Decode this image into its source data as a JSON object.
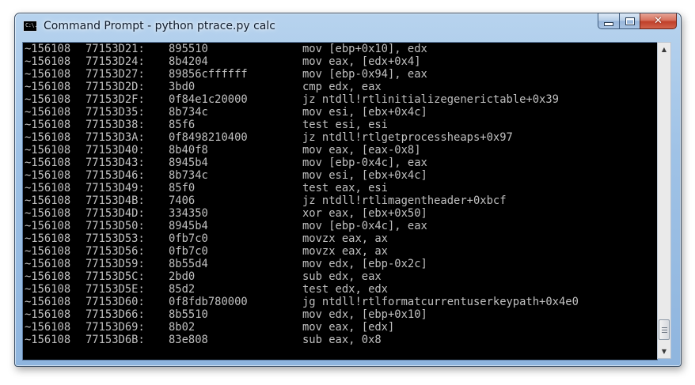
{
  "window": {
    "title": "Command Prompt - python  ptrace.py calc",
    "icon": "cmd-icon",
    "icon_text": "C:\\."
  },
  "caption_buttons": {
    "minimize_icon": "minimize-icon",
    "maximize_icon": "maximize-icon",
    "close_icon": "close-icon",
    "close_glyph": "✕"
  },
  "colors": {
    "console_background": "#000000",
    "console_text": "#c0c0c0"
  },
  "scrollbar": {
    "up_glyph": "▲",
    "down_glyph": "▼"
  },
  "console": {
    "lines": [
      {
        "pid": "~156108",
        "addr": "77153D21:",
        "bytes": "895510",
        "instr": "mov [ebp+0x10], edx"
      },
      {
        "pid": "~156108",
        "addr": "77153D24:",
        "bytes": "8b4204",
        "instr": "mov eax, [edx+0x4]"
      },
      {
        "pid": "~156108",
        "addr": "77153D27:",
        "bytes": "89856cffffff",
        "instr": "mov [ebp-0x94], eax"
      },
      {
        "pid": "~156108",
        "addr": "77153D2D:",
        "bytes": "3bd0",
        "instr": "cmp edx, eax"
      },
      {
        "pid": "~156108",
        "addr": "77153D2F:",
        "bytes": "0f84e1c20000",
        "instr": "jz ntdll!rtlinitializegenerictable+0x39"
      },
      {
        "pid": "~156108",
        "addr": "77153D35:",
        "bytes": "8b734c",
        "instr": "mov esi, [ebx+0x4c]"
      },
      {
        "pid": "~156108",
        "addr": "77153D38:",
        "bytes": "85f6",
        "instr": "test esi, esi"
      },
      {
        "pid": "~156108",
        "addr": "77153D3A:",
        "bytes": "0f8498210400",
        "instr": "jz ntdll!rtlgetprocessheaps+0x97"
      },
      {
        "pid": "~156108",
        "addr": "77153D40:",
        "bytes": "8b40f8",
        "instr": "mov eax, [eax-0x8]"
      },
      {
        "pid": "~156108",
        "addr": "77153D43:",
        "bytes": "8945b4",
        "instr": "mov [ebp-0x4c], eax"
      },
      {
        "pid": "~156108",
        "addr": "77153D46:",
        "bytes": "8b734c",
        "instr": "mov esi, [ebx+0x4c]"
      },
      {
        "pid": "~156108",
        "addr": "77153D49:",
        "bytes": "85f0",
        "instr": "test eax, esi"
      },
      {
        "pid": "~156108",
        "addr": "77153D4B:",
        "bytes": "7406",
        "instr": "jz ntdll!rtlimagentheader+0xbcf"
      },
      {
        "pid": "~156108",
        "addr": "77153D4D:",
        "bytes": "334350",
        "instr": "xor eax, [ebx+0x50]"
      },
      {
        "pid": "~156108",
        "addr": "77153D50:",
        "bytes": "8945b4",
        "instr": "mov [ebp-0x4c], eax"
      },
      {
        "pid": "~156108",
        "addr": "77153D53:",
        "bytes": "0fb7c0",
        "instr": "movzx eax, ax"
      },
      {
        "pid": "~156108",
        "addr": "77153D56:",
        "bytes": "0fb7c0",
        "instr": "movzx eax, ax"
      },
      {
        "pid": "~156108",
        "addr": "77153D59:",
        "bytes": "8b55d4",
        "instr": "mov edx, [ebp-0x2c]"
      },
      {
        "pid": "~156108",
        "addr": "77153D5C:",
        "bytes": "2bd0",
        "instr": "sub edx, eax"
      },
      {
        "pid": "~156108",
        "addr": "77153D5E:",
        "bytes": "85d2",
        "instr": "test edx, edx"
      },
      {
        "pid": "~156108",
        "addr": "77153D60:",
        "bytes": "0f8fdb780000",
        "instr": "jg ntdll!rtlformatcurrentuserkeypath+0x4e0"
      },
      {
        "pid": "~156108",
        "addr": "77153D66:",
        "bytes": "8b5510",
        "instr": "mov edx, [ebp+0x10]"
      },
      {
        "pid": "~156108",
        "addr": "77153D69:",
        "bytes": "8b02",
        "instr": "mov eax, [edx]"
      },
      {
        "pid": "~156108",
        "addr": "77153D6B:",
        "bytes": "83e808",
        "instr": "sub eax, 0x8"
      }
    ]
  }
}
